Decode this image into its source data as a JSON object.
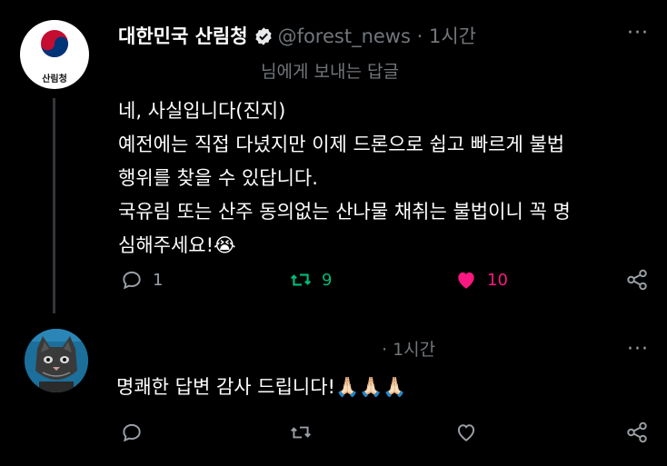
{
  "tweet": {
    "author_name": "대한민국 산림청",
    "handle": "@forest_news",
    "time": "· 1시간",
    "avatar_label": "산림청",
    "replying_to": "님에게 보내는 답글",
    "lines": [
      "네, 사실입니다(진지)",
      "예전에는 직접 다녔지만 이제 드론으로 쉽고 빠르게 불법",
      "행위를 찾을 수 있답니다.",
      "국유림 또는 산주 동의없는 산나물 채취는 불법이니 꼭 명",
      "심해주세요!😭"
    ],
    "reply_count": "1",
    "retweet_count": "9",
    "like_count": "10",
    "like_color": "#f91880",
    "retweet_color": "#00ba7c",
    "more": "···"
  },
  "reply": {
    "time": "· 1시간",
    "text": "명쾌한 답변 감사 드립니다!🙏🏻🙏🏻🙏🏻",
    "more": "···"
  },
  "icons": [
    "reply-icon",
    "retweet-icon",
    "like-icon",
    "share-icon",
    "verified-icon",
    "more-icon"
  ]
}
